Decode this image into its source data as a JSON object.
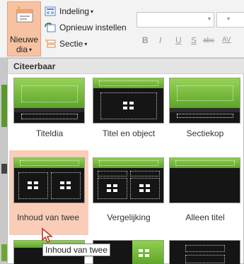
{
  "ribbon": {
    "new_slide_label_line1": "Nieuwe",
    "new_slide_label_line2": "dia",
    "layout_label": "Indeling",
    "reset_label": "Opnieuw instellen",
    "section_label": "Sectie",
    "dropdown_arrow": "▾",
    "format_buttons": [
      "B",
      "I",
      "U",
      "S",
      "abc",
      "AV"
    ]
  },
  "gallery": {
    "header": "Citeerbaar",
    "layouts": [
      {
        "label": "Titeldia",
        "icon": "title-slide-layout-icon"
      },
      {
        "label": "Titel en object",
        "icon": "title-content-layout-icon"
      },
      {
        "label": "Sectiekop",
        "icon": "section-header-layout-icon"
      },
      {
        "label": "Inhoud van twee",
        "icon": "two-content-layout-icon"
      },
      {
        "label": "Vergelijking",
        "icon": "comparison-layout-icon"
      },
      {
        "label": "Alleen titel",
        "icon": "title-only-layout-icon"
      }
    ],
    "selected_index": 3
  },
  "tooltip": {
    "text": "Inhoud van twee"
  },
  "colors": {
    "accent_green": "#6aa736",
    "selected_bg": "#f9cdb8",
    "slide_dark": "#151515"
  }
}
